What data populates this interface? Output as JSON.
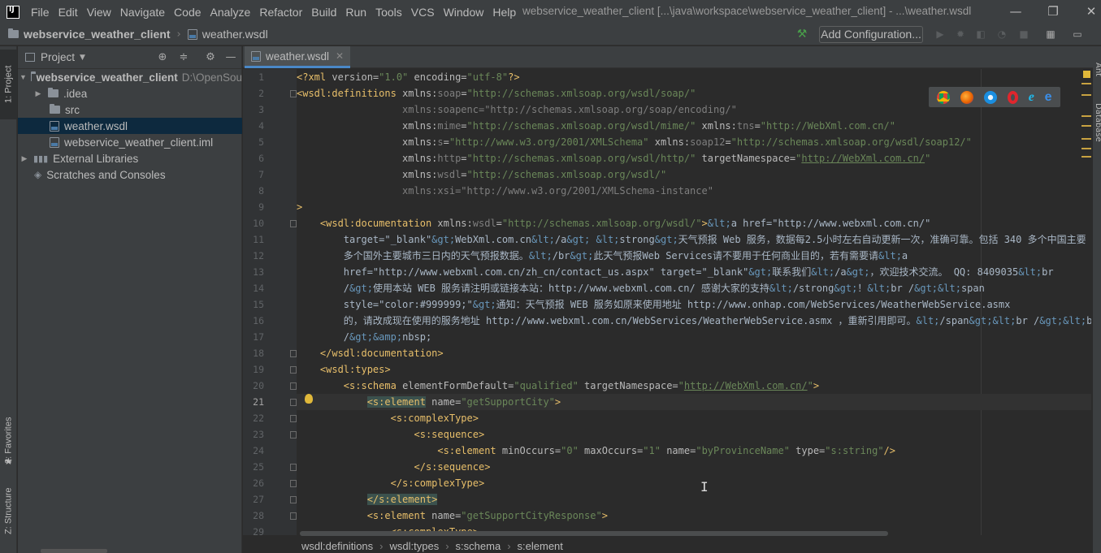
{
  "window": {
    "title": "webservice_weather_client [...\\java\\workspace\\webservice_weather_client] - ...\\weather.wsdl",
    "minimize": "—",
    "restore": "❐",
    "close": "✕"
  },
  "menu": {
    "items": [
      "File",
      "Edit",
      "View",
      "Navigate",
      "Code",
      "Analyze",
      "Refactor",
      "Build",
      "Run",
      "Tools",
      "VCS",
      "Window",
      "Help"
    ]
  },
  "navbar": {
    "project": "webservice_weather_client",
    "file": "weather.wsdl",
    "add_configuration": "Add Configuration..."
  },
  "left_strip": {
    "project_tab": "1: Project",
    "favorites_tab": "2: Favorites",
    "structure_tab": "Z: Structure"
  },
  "project_panel": {
    "title": "Project",
    "tree": [
      {
        "label": "webservice_weather_client",
        "hint": "D:\\OpenSou"
      },
      {
        "label": ".idea"
      },
      {
        "label": "src"
      },
      {
        "label": "weather.wsdl"
      },
      {
        "label": "webservice_weather_client.iml"
      },
      {
        "label": "External Libraries"
      },
      {
        "label": "Scratches and Consoles"
      }
    ]
  },
  "editor": {
    "tab": "weather.wsdl",
    "current_line": 21,
    "line_numbers": [
      "1",
      "2",
      "3",
      "4",
      "5",
      "6",
      "7",
      "8",
      "9",
      "10",
      "11",
      "12",
      "13",
      "14",
      "15",
      "16",
      "17",
      "18",
      "19",
      "20",
      "21",
      "22",
      "23",
      "24",
      "25",
      "26",
      "27",
      "28",
      "29"
    ],
    "breadcrumbs": [
      "wsdl:definitions",
      "wsdl:types",
      "s:schema",
      "s:element"
    ]
  },
  "browsers": [
    "chrome",
    "firefox",
    "safari",
    "opera",
    "ie",
    "edge"
  ],
  "colors": {
    "tag": "#e8bf6a",
    "string": "#6a8759",
    "entity": "#6897bb",
    "selection": "#0d293e",
    "tab_underline": "#4a88c7"
  },
  "code_lines": [
    [
      [
        "<?",
        "tk-tag"
      ],
      [
        "xml ",
        "tk-tag"
      ],
      [
        "version=",
        "tk-attr"
      ],
      [
        "\"1.0\"",
        "tk-str"
      ],
      [
        " encoding=",
        "tk-attr"
      ],
      [
        "\"utf-8\"",
        "tk-str"
      ],
      [
        "?>",
        "tk-tag"
      ]
    ],
    [
      [
        "<",
        "tk-tag"
      ],
      [
        "wsdl:definitions ",
        "tk-tag"
      ],
      [
        "xmlns:",
        "tk-attr"
      ],
      [
        "soap",
        "tk-dim"
      ],
      [
        "=",
        "tk-attr"
      ],
      [
        "\"http://schemas.xmlsoap.org/wsdl/soap/\"",
        "tk-str"
      ]
    ],
    [
      [
        "                  xmlns:soapenc=\"http://schemas.xmlsoap.org/soap/encoding/\"",
        "tk-dim"
      ]
    ],
    [
      [
        "                  xmlns:",
        "tk-attr"
      ],
      [
        "mime",
        "tk-dim"
      ],
      [
        "=",
        "tk-attr"
      ],
      [
        "\"http://schemas.xmlsoap.org/wsdl/mime/\"",
        "tk-str"
      ],
      [
        " xmlns:",
        "tk-attr"
      ],
      [
        "tns",
        "tk-dim"
      ],
      [
        "=",
        "tk-attr"
      ],
      [
        "\"http://WebXml.com.cn/\"",
        "tk-str"
      ]
    ],
    [
      [
        "                  xmlns:",
        "tk-attr"
      ],
      [
        "s",
        "tk-dim"
      ],
      [
        "=",
        "tk-attr"
      ],
      [
        "\"http://www.w3.org/2001/XMLSchema\"",
        "tk-str"
      ],
      [
        " xmlns:",
        "tk-attr"
      ],
      [
        "soap12",
        "tk-dim"
      ],
      [
        "=",
        "tk-attr"
      ],
      [
        "\"http://schemas.xmlsoap.org/wsdl/soap12/\"",
        "tk-str"
      ]
    ],
    [
      [
        "                  xmlns:",
        "tk-attr"
      ],
      [
        "http",
        "tk-dim"
      ],
      [
        "=",
        "tk-attr"
      ],
      [
        "\"http://schemas.xmlsoap.org/wsdl/http/\"",
        "tk-str"
      ],
      [
        " targetNamespace=",
        "tk-attr"
      ],
      [
        "\"",
        "tk-str"
      ],
      [
        "http://WebXml.com.cn/",
        "tk-url"
      ],
      [
        "\"",
        "tk-str"
      ]
    ],
    [
      [
        "                  xmlns:",
        "tk-attr"
      ],
      [
        "wsdl",
        "tk-dim"
      ],
      [
        "=",
        "tk-attr"
      ],
      [
        "\"http://schemas.xmlsoap.org/wsdl/\"",
        "tk-str"
      ]
    ],
    [
      [
        "                  xmlns:xsi=\"http://www.w3.org/2001/XMLSchema-instance\"",
        "tk-dim"
      ]
    ],
    [
      [
        ">",
        "tk-tag"
      ]
    ],
    [
      [
        "    <",
        "tk-tag"
      ],
      [
        "wsdl:documentation ",
        "tk-tag"
      ],
      [
        "xmlns:",
        "tk-attr"
      ],
      [
        "wsdl",
        "tk-dim"
      ],
      [
        "=",
        "tk-attr"
      ],
      [
        "\"http://schemas.xmlsoap.org/wsdl/\"",
        "tk-str"
      ],
      [
        ">",
        "tk-tag"
      ],
      [
        "&lt;",
        "tk-ent"
      ],
      [
        "a href=\"http://www.webxml.com.cn/\"",
        "tk-text"
      ]
    ],
    [
      [
        "        target=\"_blank\"",
        "tk-text"
      ],
      [
        "&gt;",
        "tk-ent"
      ],
      [
        "WebXml.com.cn",
        "tk-text"
      ],
      [
        "&lt;",
        "tk-ent"
      ],
      [
        "/a",
        "tk-text"
      ],
      [
        "&gt;",
        "tk-ent"
      ],
      [
        " ",
        "tk-text"
      ],
      [
        "&lt;",
        "tk-ent"
      ],
      [
        "strong",
        "tk-text"
      ],
      [
        "&gt;",
        "tk-ent"
      ],
      [
        "天气预报 Web 服务，数据每2.5小时左右自动更新一次，准确可靠。包括 340 多个中国主要",
        "tk-text"
      ]
    ],
    [
      [
        "        多个国外主要城市三日内的天气预报数据。",
        "tk-text"
      ],
      [
        "&lt;",
        "tk-ent"
      ],
      [
        "/br",
        "tk-text"
      ],
      [
        "&gt;",
        "tk-ent"
      ],
      [
        "此天气预报Web Services请不要用于任何商业目的，若有需要请",
        "tk-text"
      ],
      [
        "&lt;",
        "tk-ent"
      ],
      [
        "a",
        "tk-text"
      ]
    ],
    [
      [
        "        href=\"http://www.webxml.com.cn/zh_cn/contact_us.aspx\" target=\"_blank\"",
        "tk-text"
      ],
      [
        "&gt;",
        "tk-ent"
      ],
      [
        "联系我们",
        "tk-text"
      ],
      [
        "&lt;",
        "tk-ent"
      ],
      [
        "/a",
        "tk-text"
      ],
      [
        "&gt;",
        "tk-ent"
      ],
      [
        "，欢迎技术交流。 QQ: 8409035",
        "tk-text"
      ],
      [
        "&lt;",
        "tk-ent"
      ],
      [
        "br",
        "tk-text"
      ]
    ],
    [
      [
        "        /",
        "tk-text"
      ],
      [
        "&gt;",
        "tk-ent"
      ],
      [
        "使用本站 WEB 服务请注明或链接本站：http://www.webxml.com.cn/ 感谢大家的支持",
        "tk-text"
      ],
      [
        "&lt;",
        "tk-ent"
      ],
      [
        "/strong",
        "tk-text"
      ],
      [
        "&gt;",
        "tk-ent"
      ],
      [
        "！",
        "tk-text"
      ],
      [
        "&lt;",
        "tk-ent"
      ],
      [
        "br /",
        "tk-text"
      ],
      [
        "&gt;",
        "tk-ent"
      ],
      [
        "&lt;",
        "tk-ent"
      ],
      [
        "span",
        "tk-text"
      ]
    ],
    [
      [
        "        style=\"color:#999999;\"",
        "tk-text"
      ],
      [
        "&gt;",
        "tk-ent"
      ],
      [
        "通知：天气预报 WEB 服务如原来使用地址 http://www.onhap.com/WebServices/WeatherWebService.asmx",
        "tk-text"
      ]
    ],
    [
      [
        "        的，请改成现在使用的服务地址 http://www.webxml.com.cn/WebServices/WeatherWebService.asmx ，重新引用即可。",
        "tk-text"
      ],
      [
        "&lt;",
        "tk-ent"
      ],
      [
        "/span",
        "tk-text"
      ],
      [
        "&gt;",
        "tk-ent"
      ],
      [
        "&lt;",
        "tk-ent"
      ],
      [
        "br /",
        "tk-text"
      ],
      [
        "&gt;",
        "tk-ent"
      ],
      [
        "&lt;",
        "tk-ent"
      ],
      [
        "b",
        "tk-text"
      ]
    ],
    [
      [
        "        /",
        "tk-text"
      ],
      [
        "&gt;",
        "tk-ent"
      ],
      [
        "&amp;",
        "tk-ent"
      ],
      [
        "nbsp;",
        "tk-text"
      ]
    ],
    [
      [
        "    </",
        "tk-tag"
      ],
      [
        "wsdl:documentation",
        "tk-tag"
      ],
      [
        ">",
        "tk-tag"
      ]
    ],
    [
      [
        "    <",
        "tk-tag"
      ],
      [
        "wsdl:types",
        "tk-tag"
      ],
      [
        ">",
        "tk-tag"
      ]
    ],
    [
      [
        "        <",
        "tk-tag"
      ],
      [
        "s:schema ",
        "tk-tag"
      ],
      [
        "elementFormDefault=",
        "tk-attr"
      ],
      [
        "\"qualified\"",
        "tk-str"
      ],
      [
        " targetNamespace=",
        "tk-attr"
      ],
      [
        "\"",
        "tk-str"
      ],
      [
        "http://WebXml.com.cn/",
        "tk-url"
      ],
      [
        "\"",
        "tk-str"
      ],
      [
        ">",
        "tk-tag"
      ]
    ],
    [
      [
        "            ",
        "tk-text"
      ],
      [
        "<s:element",
        "tk-tag hl-tag"
      ],
      [
        " name=",
        "tk-attr"
      ],
      [
        "\"getSupportCity\"",
        "tk-str"
      ],
      [
        ">",
        "tk-tag"
      ]
    ],
    [
      [
        "                <",
        "tk-tag"
      ],
      [
        "s:complexType",
        "tk-tag"
      ],
      [
        ">",
        "tk-tag"
      ]
    ],
    [
      [
        "                    <",
        "tk-tag"
      ],
      [
        "s:sequence",
        "tk-tag"
      ],
      [
        ">",
        "tk-tag"
      ]
    ],
    [
      [
        "                        <",
        "tk-tag"
      ],
      [
        "s:element ",
        "tk-tag"
      ],
      [
        "minOccurs=",
        "tk-attr"
      ],
      [
        "\"0\"",
        "tk-str"
      ],
      [
        " maxOccurs=",
        "tk-attr"
      ],
      [
        "\"1\"",
        "tk-str"
      ],
      [
        " name=",
        "tk-attr"
      ],
      [
        "\"byProvinceName\"",
        "tk-str"
      ],
      [
        " type=",
        "tk-attr"
      ],
      [
        "\"s:string\"",
        "tk-str"
      ],
      [
        "/>",
        "tk-tag"
      ]
    ],
    [
      [
        "                    </",
        "tk-tag"
      ],
      [
        "s:sequence",
        "tk-tag"
      ],
      [
        ">",
        "tk-tag"
      ]
    ],
    [
      [
        "                </",
        "tk-tag"
      ],
      [
        "s:complexType",
        "tk-tag"
      ],
      [
        ">",
        "tk-tag"
      ]
    ],
    [
      [
        "            ",
        "tk-text"
      ],
      [
        "</s:element>",
        "tk-tag hl-tag"
      ]
    ],
    [
      [
        "            <",
        "tk-tag"
      ],
      [
        "s:element ",
        "tk-tag"
      ],
      [
        "name=",
        "tk-attr"
      ],
      [
        "\"getSupportCityResponse\"",
        "tk-str"
      ],
      [
        ">",
        "tk-tag"
      ]
    ],
    [
      [
        "                <",
        "tk-tag"
      ],
      [
        "s:complexType",
        "tk-tag"
      ],
      [
        ">",
        "tk-tag"
      ]
    ]
  ]
}
